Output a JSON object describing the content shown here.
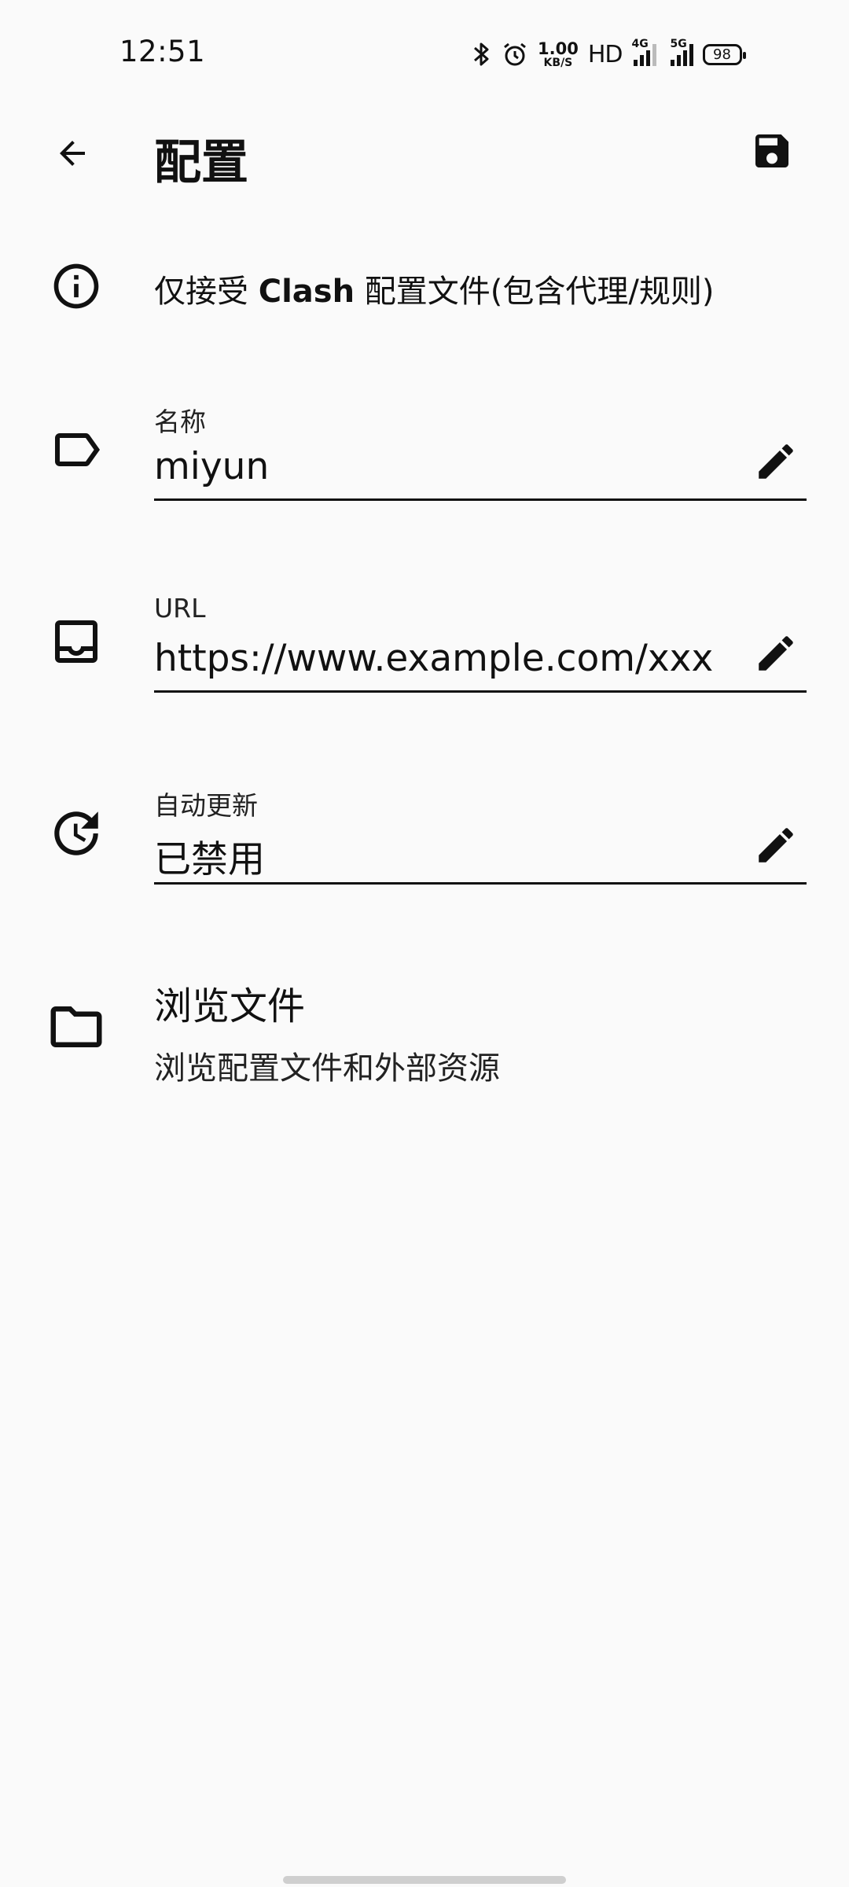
{
  "status_bar": {
    "time": "12:51",
    "net_speed_value": "1.00",
    "net_speed_unit": "KB/S",
    "hd_label": "HD",
    "sim1_label": "4G",
    "sim2_label": "5G",
    "battery": "98",
    "icons": [
      "bluetooth-icon",
      "alarm-icon",
      "signal-4g-icon",
      "signal-5g-icon",
      "battery-icon"
    ]
  },
  "app_bar": {
    "title": "配置",
    "back_icon": "arrow-back-icon",
    "save_icon": "save-icon"
  },
  "notice": {
    "prefix": "仅接受 ",
    "bold": "Clash",
    "suffix": " 配置文件(包含代理/规则)",
    "icon": "info-icon"
  },
  "fields": {
    "name": {
      "label": "名称",
      "value": "miyun",
      "icon": "label-tag-icon"
    },
    "url": {
      "label": "URL",
      "value": "https://www.example.com/xxx",
      "icon": "inbox-icon"
    },
    "auto_update": {
      "label": "自动更新",
      "value": "已禁用",
      "icon": "update-clock-icon"
    }
  },
  "browse": {
    "title": "浏览文件",
    "subtitle": "浏览配置文件和外部资源",
    "icon": "folder-icon"
  }
}
